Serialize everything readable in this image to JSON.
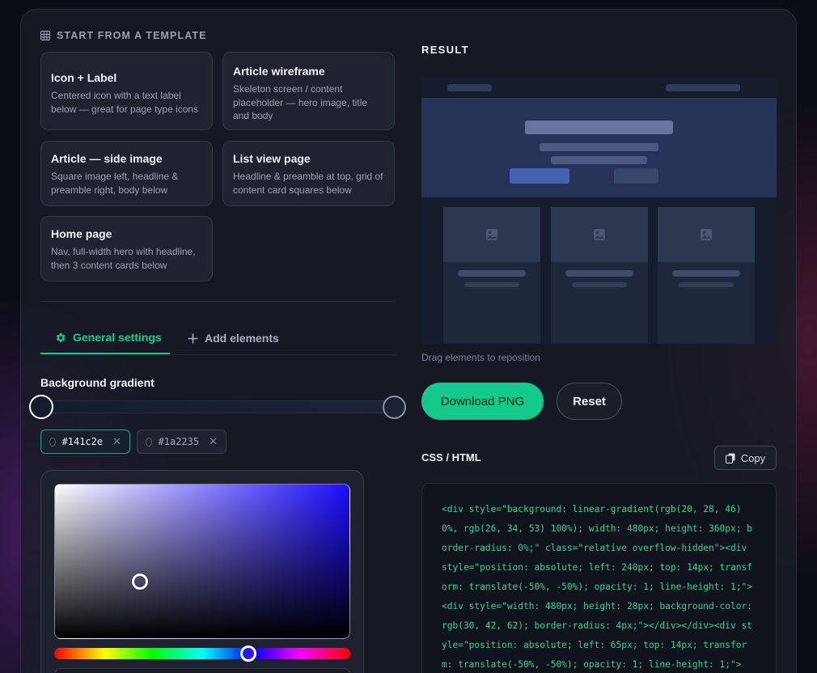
{
  "templates_section": {
    "title": "START FROM A TEMPLATE",
    "icon": "grid-icon",
    "items": [
      {
        "title": "Icon + Label",
        "desc": "Centered icon with a text label below — great for page type icons"
      },
      {
        "title": "Article wireframe",
        "desc": "Skeleton screen / content placeholder — hero image, title and body"
      },
      {
        "title": "Article — side image",
        "desc": "Square image left, headline & preamble right, body below"
      },
      {
        "title": "List view page",
        "desc": "Headline & preamble at top, grid of content card squares below"
      },
      {
        "title": "Home page",
        "desc": "Nav, full-width hero with headline, then 3 content cards below"
      }
    ]
  },
  "tabs": [
    {
      "label": "General settings",
      "icon": "gear-icon",
      "active": true
    },
    {
      "label": "Add elements",
      "icon": "plus-icon",
      "active": false
    }
  ],
  "background_gradient": {
    "label": "Background gradient",
    "stops": [
      {
        "color": "#141c2e",
        "label": "#141c2e",
        "selected": true
      },
      {
        "color": "#1a2235",
        "label": "#1a2235",
        "selected": false
      }
    ],
    "picker": {
      "hue_color": "#1c0cff"
    }
  },
  "result": {
    "title": "RESULT",
    "hint": "Drag elements to reposition",
    "download_label": "Download PNG",
    "reset_label": "Reset"
  },
  "code": {
    "title": "CSS / HTML",
    "copy_label": "Copy",
    "content": "<div style=\"background: linear-gradient(rgb(20, 28, 46) 0%, rgb(26, 34, 53) 100%); width: 480px; height: 360px; border-radius: 0%;\" class=\"relative overflow-hidden\"><div style=\"position: absolute; left: 240px; top: 14px; transform: translate(-50%, -50%); opacity: 1; line-height: 1;\"><div style=\"width: 480px; height: 28px; background-color: rgb(30, 42, 62); border-radius: 4px;\"></div></div><div style=\"position: absolute; left: 65px; top: 14px; transform: translate(-50%, -50%); opacity: 1; line-height: 1;\">"
  },
  "colors": {
    "accent": "#14c98c",
    "canvas_bg": "#141c2e"
  }
}
